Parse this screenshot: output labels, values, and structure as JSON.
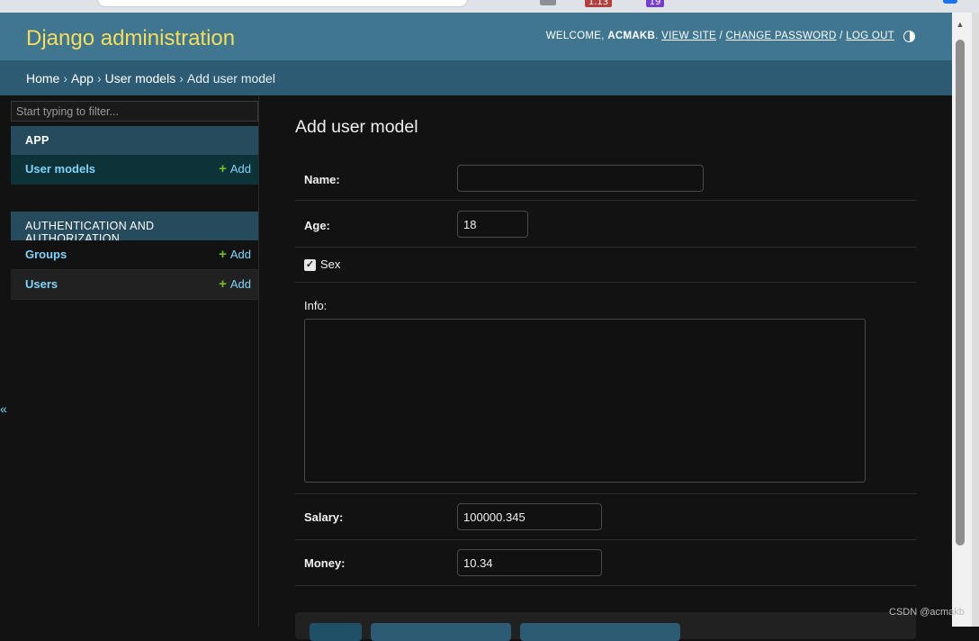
{
  "browser": {
    "extension_badge_1": "1.13",
    "extension_badge_2": "19"
  },
  "header": {
    "site_title": "Django administration",
    "welcome_prefix": "WELCOME, ",
    "username": "ACMAKB",
    "username_suffix": ". ",
    "view_site": "VIEW SITE",
    "sep1": " / ",
    "change_password": "CHANGE PASSWORD",
    "sep2": " / ",
    "log_out": "LOG OUT",
    "theme_icon": "half-circle-theme-icon"
  },
  "breadcrumbs": {
    "home": "Home",
    "app": "App",
    "user_models": "User models",
    "current": "Add user model",
    "separator": "›"
  },
  "sidebar": {
    "filter_placeholder": "Start typing to filter...",
    "modules": [
      {
        "caption": "APP",
        "models": [
          {
            "name": "User models",
            "add_label": "Add"
          }
        ]
      },
      {
        "caption": "AUTHENTICATION AND AUTHORIZATION",
        "models": [
          {
            "name": "Groups",
            "add_label": "Add"
          },
          {
            "name": "Users",
            "add_label": "Add"
          }
        ]
      }
    ],
    "collapse_glyph": "«"
  },
  "content": {
    "title": "Add user model",
    "fields": {
      "name": {
        "label": "Name:",
        "value": ""
      },
      "age": {
        "label": "Age:",
        "value": "18"
      },
      "sex": {
        "label": "Sex",
        "checked": true,
        "check_glyph": "✓"
      },
      "info": {
        "label": "Info:",
        "value": ""
      },
      "salary": {
        "label": "Salary:",
        "value": "100000.345"
      },
      "money": {
        "label": "Money:",
        "value": "10.34"
      }
    }
  },
  "watermark": "CSDN @acmakb",
  "colors": {
    "header_bg": "#417690",
    "breadcrumbs_bg": "#2c5b73",
    "site_title": "#f5dd5d",
    "link": "#81d4fa",
    "add_plus": "#70bf2b",
    "module_caption_bg": "#264b5d",
    "page_bg": "#121212"
  }
}
